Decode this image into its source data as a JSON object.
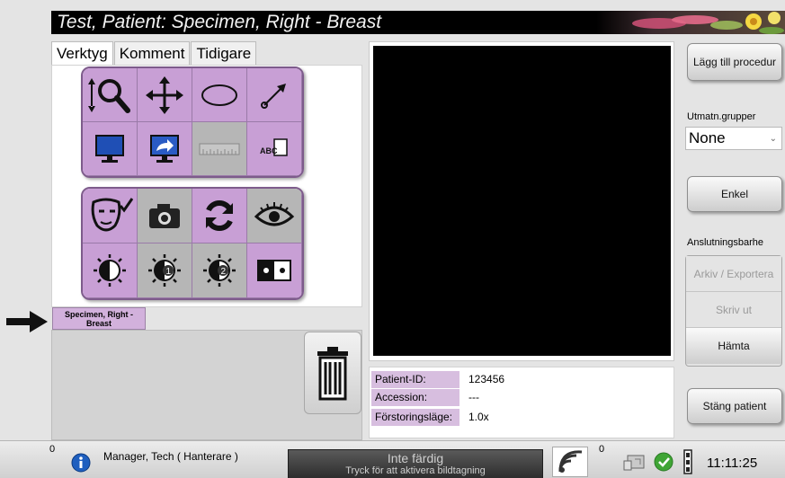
{
  "title": "Test, Patient:  Specimen, Right - Breast",
  "tabs": [
    "Verktyg",
    "Komment",
    "Tidigare"
  ],
  "tools_row1": [
    "magnifier-icon",
    "pan-icon",
    "ellipse-icon",
    "arrow-icon"
  ],
  "tools_row2": [
    "monitor-icon",
    "send-monitor-icon",
    "ruler-icon",
    "text-label-icon"
  ],
  "tools_row3": [
    "face-check-icon",
    "camera-icon",
    "refresh-icon",
    "eye-icon"
  ],
  "tools_row4": [
    "contrast-icon",
    "contrast-1-icon",
    "contrast-2-icon",
    "dual-view-icon"
  ],
  "ruler_text": "",
  "text_tool_label": "ABC",
  "contrast_numbers": [
    "1",
    "2"
  ],
  "specimen_tab": "Specimen, Right - Breast",
  "info": {
    "patient_id_label": "Patient-ID:",
    "patient_id": "123456",
    "accession_label": "Accession:",
    "accession": "---",
    "zoom_label": "Förstoringsläge:",
    "zoom": "1.0x"
  },
  "right": {
    "add_procedure": "Lägg till procedur",
    "output_groups_label": "Utmatn.grupper",
    "output_group_value": "None",
    "simple": "Enkel",
    "connections_label": "Anslutningsbarhe",
    "archive_export": "Arkiv / Exportera",
    "print": "Skriv ut",
    "fetch": "Hämta",
    "close_patient": "Stäng patient"
  },
  "status": {
    "left_count": "0",
    "user": "Manager, Tech ( Hanterare )",
    "state_title": "Inte färdig",
    "state_sub": "Tryck för att aktivera bildtagning",
    "right_count": "0",
    "time": "11:11:25"
  },
  "colors": {
    "tool_purple": "#c89fd5",
    "tool_grey": "#b6b6b6",
    "info_label_bg": "#d7bedf"
  }
}
